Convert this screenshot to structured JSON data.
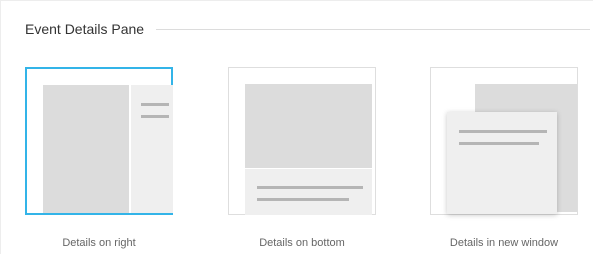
{
  "section": {
    "title": "Event Details Pane"
  },
  "options": [
    {
      "id": "right",
      "label": "Details on right",
      "selected": true
    },
    {
      "id": "bottom",
      "label": "Details on bottom",
      "selected": false
    },
    {
      "id": "window",
      "label": "Details in new window",
      "selected": false
    }
  ],
  "colors": {
    "selected_border": "#33b4e8",
    "border": "#dedede",
    "placeholder": "#dcdcdc",
    "pane": "#efefef",
    "line": "#b5b5b5"
  }
}
